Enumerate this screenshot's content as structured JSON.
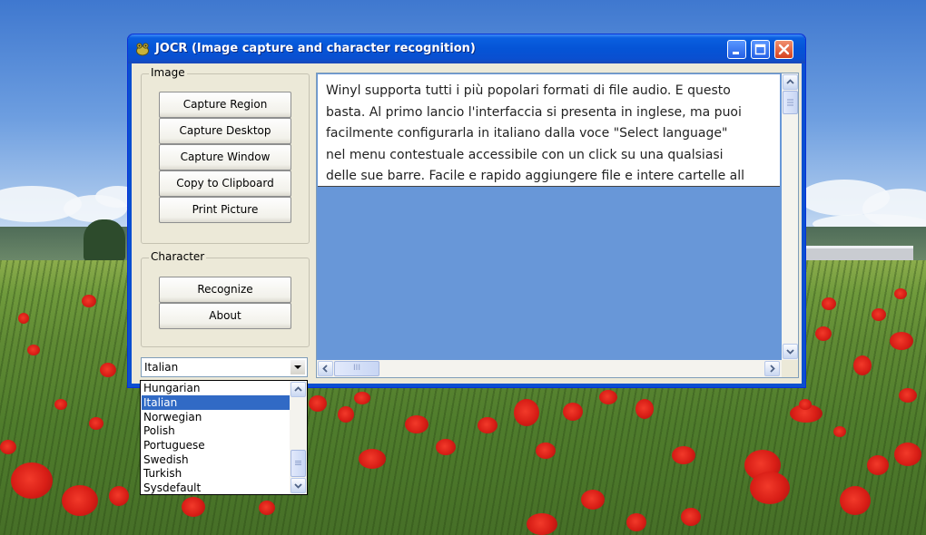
{
  "window": {
    "title": "JOCR (Image capture and character recognition)"
  },
  "image_group": {
    "label": "Image",
    "buttons": [
      "Capture Region",
      "Capture Desktop",
      "Capture Window",
      "Copy to Clipboard",
      "Print Picture"
    ]
  },
  "character_group": {
    "label": "Character",
    "buttons": [
      "Recognize",
      "About"
    ]
  },
  "ocr_text": {
    "lines": [
      "Winyl supporta tutti i più popolari formati di file audio. E questo",
      "basta. Al primo lancio l'interfaccia si presenta in inglese, ma puoi",
      "facilmente configurarla in italiano dalla voce \"Select language\"",
      "nel menu contestuale accessibile con un click su una qualsiasi",
      "delle sue barre. Facile e rapido aggiungere file e intere cartelle all"
    ]
  },
  "language": {
    "selected": "Italian",
    "options": [
      "Hungarian",
      "Italian",
      "Norwegian",
      "Polish",
      "Portuguese",
      "Swedish",
      "Turkish",
      "Sysdefault"
    ],
    "scroll_thumb_glyph": "≡",
    "hscroll_thumb_glyph": "III"
  },
  "colors": {
    "titlebar": "#0554d6",
    "selection": "#316ac5",
    "text_area_bg": "#6897d8"
  }
}
